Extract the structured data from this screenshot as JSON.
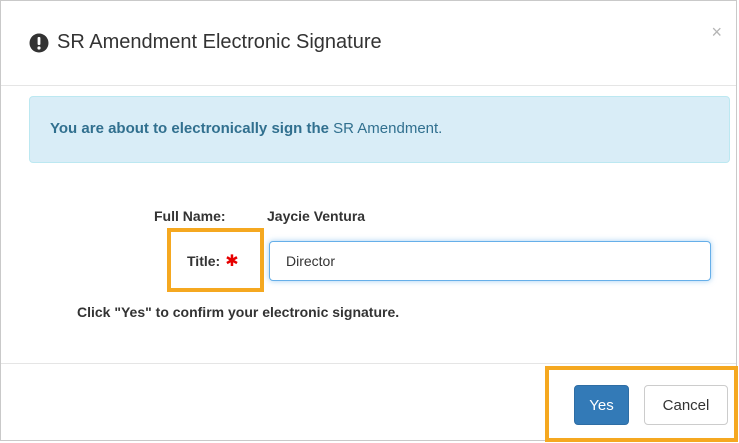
{
  "dialog": {
    "title": "SR Amendment Electronic Signature",
    "close_symbol": "×",
    "header_icon": "exclamation-circle-icon"
  },
  "alert": {
    "bold_text": "You are about to electronically sign the",
    "normal_text": "SR Amendment."
  },
  "form": {
    "full_name_label": "Full Name:",
    "full_name_value": "Jaycie Ventura",
    "title_label": "Title:",
    "required_symbol": "✱",
    "title_value": "Director"
  },
  "confirm_text": "Click \"Yes\" to confirm your electronic signature.",
  "buttons": {
    "yes_label": "Yes",
    "cancel_label": "Cancel"
  },
  "colors": {
    "primary": "#337ab7",
    "alert_bg": "#d9edf7",
    "alert_text": "#31708f",
    "highlight": "#f5a820",
    "required": "#e60000"
  }
}
